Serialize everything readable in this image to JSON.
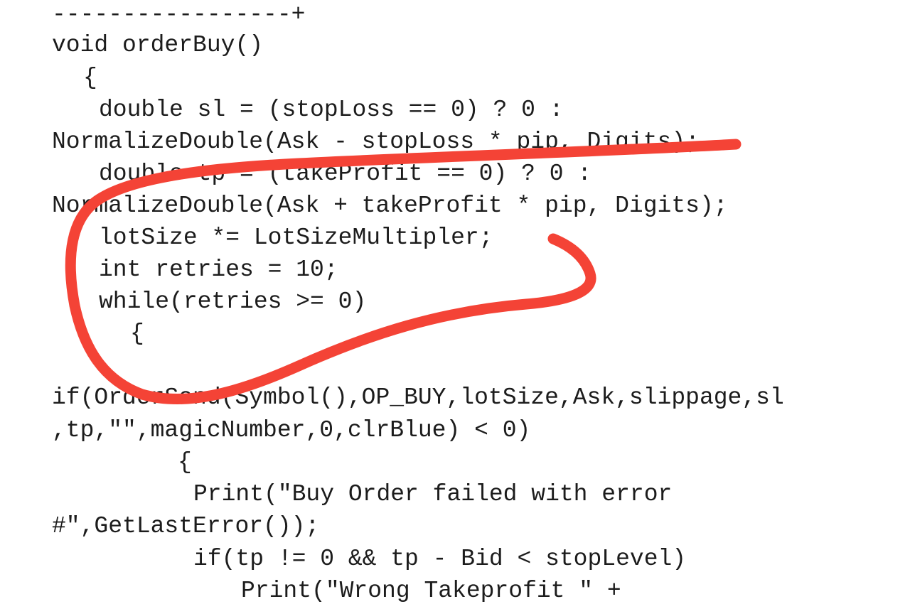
{
  "document": {
    "lines": [
      "-----------------+",
      "void orderBuy()",
      "{",
      "double sl = (stopLoss == 0) ? 0 :",
      "NormalizeDouble(Ask - stopLoss * pip, Digits);",
      "double tp = (takeProfit == 0) ? 0 :",
      "NormalizeDouble(Ask + takeProfit * pip, Digits);",
      "lotSize *= LotSizeMultipler;",
      "int retries = 10;",
      "while(retries >= 0)",
      "{",
      "if(OrderSend(Symbol(),OP_BUY,lotSize,Ask,slippage,sl",
      ",tp,\"\",magicNumber,0,clrBlue) < 0)",
      "{",
      "Print(\"Buy Order failed with error",
      "#\",GetLastError());",
      "if(tp != 0 && tp - Bid < stopLevel)",
      "Print(\"Wrong Takeprofit \" +"
    ]
  },
  "annotation": {
    "stroke_color": "#f44336"
  }
}
